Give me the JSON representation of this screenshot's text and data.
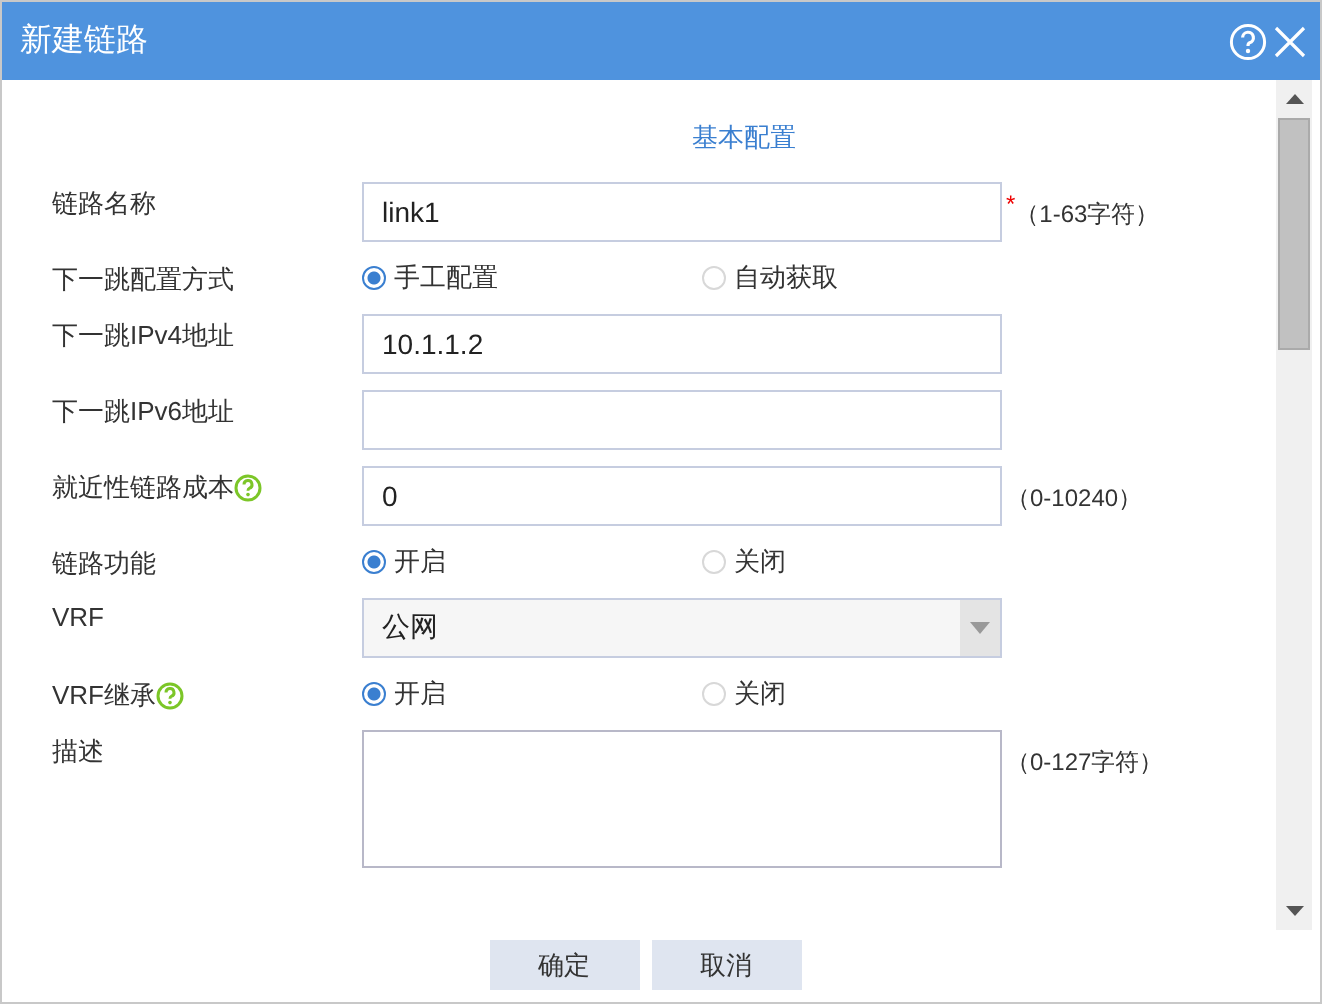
{
  "window": {
    "title": "新建链路"
  },
  "section_title": "基本配置",
  "rows": [
    {
      "kind": "text",
      "label": "链路名称",
      "value": "link1",
      "required_mark": "*",
      "hint": "（1-63字符）"
    },
    {
      "kind": "radio",
      "label": "下一跳配置方式",
      "options": [
        {
          "label": "手工配置",
          "selected": true
        },
        {
          "label": "自动获取",
          "selected": false
        }
      ]
    },
    {
      "kind": "text",
      "label": "下一跳IPv4地址",
      "value": "10.1.1.2"
    },
    {
      "kind": "text",
      "label": "下一跳IPv6地址"
    },
    {
      "kind": "text",
      "label": "就近性链路成本",
      "help": true,
      "value": "0",
      "hint": "（0-10240）"
    },
    {
      "kind": "radio",
      "label": "链路功能",
      "options": [
        {
          "label": "开启",
          "selected": true
        },
        {
          "label": "关闭",
          "selected": false
        }
      ]
    },
    {
      "kind": "select",
      "label": "VRF",
      "value": "公网"
    },
    {
      "kind": "radio",
      "label": "VRF继承",
      "help": true,
      "options": [
        {
          "label": "开启",
          "selected": true
        },
        {
          "label": "关闭",
          "selected": false
        }
      ]
    },
    {
      "kind": "textarea",
      "label": "描述",
      "hint": "（0-127字符）"
    }
  ],
  "buttons": [
    "确定",
    "取消"
  ]
}
